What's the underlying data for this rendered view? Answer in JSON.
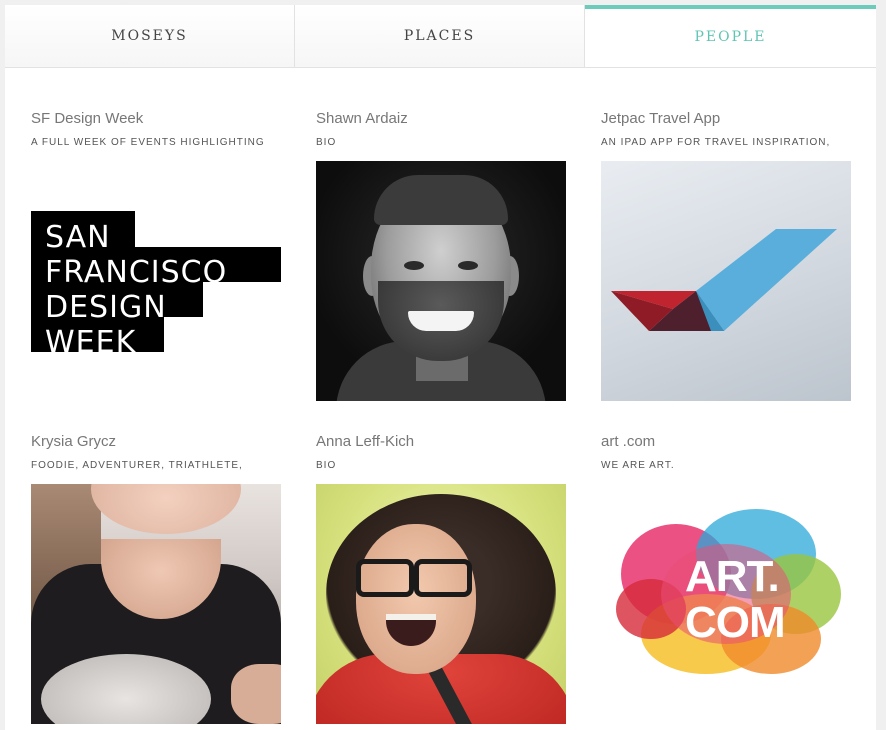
{
  "tabs": [
    {
      "label": "MOSEYS",
      "active": false
    },
    {
      "label": "PLACES",
      "active": false
    },
    {
      "label": "PEOPLE",
      "active": true
    }
  ],
  "accent_color": "#6ccbbb",
  "cards": [
    {
      "title": "SF Design Week",
      "subtitle": "A FULL WEEK OF EVENTS HIGHLIGHTING",
      "image": "sf-design-week-logo",
      "logo_lines": [
        "SAN",
        "FRANCISCO",
        "DESIGN",
        "WEEK"
      ]
    },
    {
      "title": "Shawn Ardaiz",
      "subtitle": "BIO",
      "image": "portrait-photo"
    },
    {
      "title": "Jetpac Travel App",
      "subtitle": "AN IPAD APP FOR TRAVEL INSPIRATION,",
      "image": "jetpac-logo"
    },
    {
      "title": "Krysia Grycz",
      "subtitle": "FOODIE, ADVENTURER, TRIATHLETE,",
      "image": "portrait-photo"
    },
    {
      "title": "Anna Leff-Kich",
      "subtitle": "BIO",
      "image": "portrait-photo"
    },
    {
      "title": "art .com",
      "subtitle": "WE ARE ART.",
      "image": "artcom-logo",
      "logo_lines": [
        "ART.",
        "COM"
      ]
    }
  ]
}
